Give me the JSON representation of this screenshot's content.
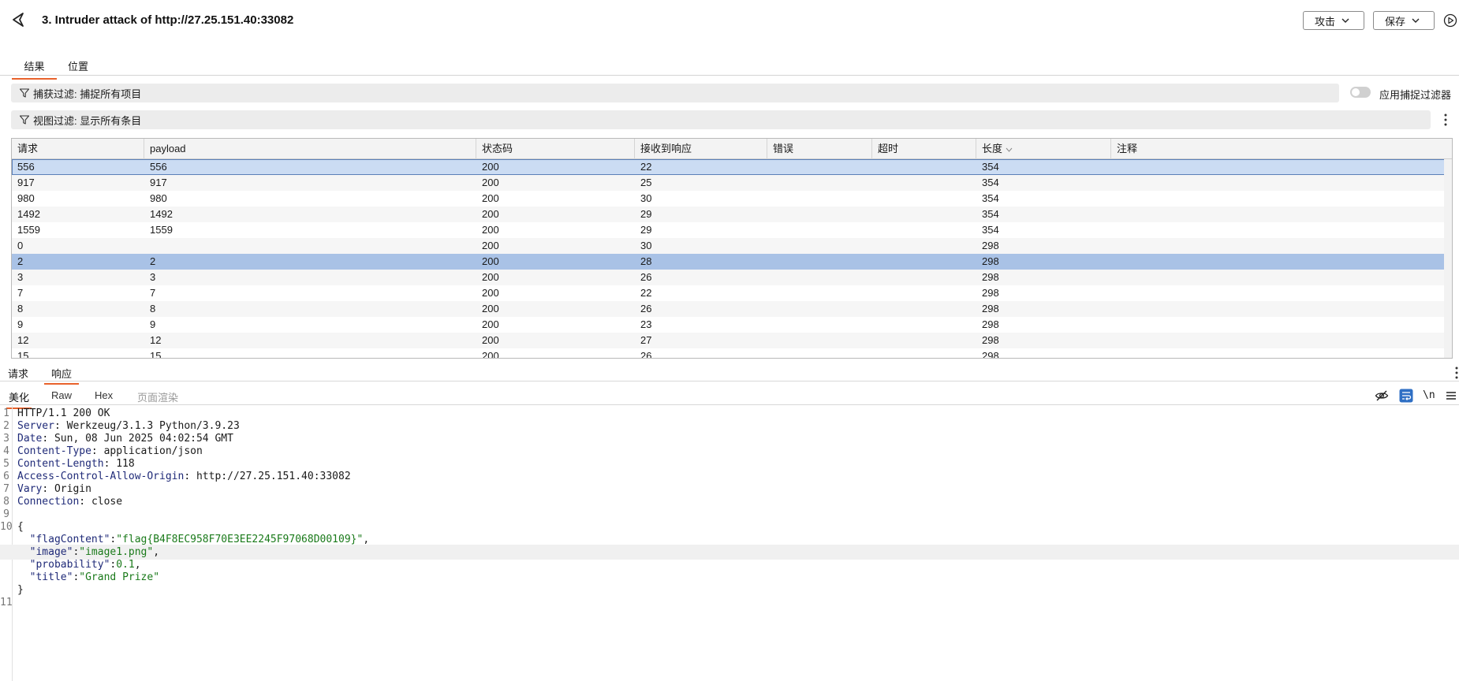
{
  "window": {
    "title": "3. Intruder attack of http://27.25.151.40:33082"
  },
  "toolbar": {
    "attack_label": "攻击",
    "save_label": "保存"
  },
  "tabs": [
    {
      "label": "结果",
      "active": true
    },
    {
      "label": "位置",
      "active": false
    }
  ],
  "filters": {
    "capture": {
      "label": "捕获过滤: 捕捉所有项目"
    },
    "view": {
      "label": "视图过滤: 显示所有条目"
    },
    "apply_toggle": {
      "label": "应用捕捉过滤器",
      "on": false
    }
  },
  "table": {
    "columns": [
      "请求",
      "payload",
      "状态码",
      "接收到响应",
      "错误",
      "超时",
      "长度",
      "注释"
    ],
    "rows": [
      {
        "request": "556",
        "payload": "556",
        "status": "200",
        "received": "22",
        "error": "",
        "timeout": "",
        "length": "354",
        "comment": "",
        "state": "focus"
      },
      {
        "request": "917",
        "payload": "917",
        "status": "200",
        "received": "25",
        "error": "",
        "timeout": "",
        "length": "354",
        "comment": ""
      },
      {
        "request": "980",
        "payload": "980",
        "status": "200",
        "received": "30",
        "error": "",
        "timeout": "",
        "length": "354",
        "comment": ""
      },
      {
        "request": "1492",
        "payload": "1492",
        "status": "200",
        "received": "29",
        "error": "",
        "timeout": "",
        "length": "354",
        "comment": ""
      },
      {
        "request": "1559",
        "payload": "1559",
        "status": "200",
        "received": "29",
        "error": "",
        "timeout": "",
        "length": "354",
        "comment": ""
      },
      {
        "request": "0",
        "payload": "",
        "status": "200",
        "received": "30",
        "error": "",
        "timeout": "",
        "length": "298",
        "comment": ""
      },
      {
        "request": "2",
        "payload": "2",
        "status": "200",
        "received": "28",
        "error": "",
        "timeout": "",
        "length": "298",
        "comment": "",
        "state": "sel"
      },
      {
        "request": "3",
        "payload": "3",
        "status": "200",
        "received": "26",
        "error": "",
        "timeout": "",
        "length": "298",
        "comment": ""
      },
      {
        "request": "7",
        "payload": "7",
        "status": "200",
        "received": "22",
        "error": "",
        "timeout": "",
        "length": "298",
        "comment": ""
      },
      {
        "request": "8",
        "payload": "8",
        "status": "200",
        "received": "26",
        "error": "",
        "timeout": "",
        "length": "298",
        "comment": ""
      },
      {
        "request": "9",
        "payload": "9",
        "status": "200",
        "received": "23",
        "error": "",
        "timeout": "",
        "length": "298",
        "comment": ""
      },
      {
        "request": "12",
        "payload": "12",
        "status": "200",
        "received": "27",
        "error": "",
        "timeout": "",
        "length": "298",
        "comment": ""
      },
      {
        "request": "15",
        "payload": "15",
        "status": "200",
        "received": "26",
        "error": "",
        "timeout": "",
        "length": "298",
        "comment": ""
      }
    ]
  },
  "detail_tabs": [
    {
      "label": "请求",
      "active": false
    },
    {
      "label": "响应",
      "active": true
    }
  ],
  "view_tabs": [
    {
      "label": "美化",
      "active": true
    },
    {
      "label": "Raw",
      "active": false
    },
    {
      "label": "Hex",
      "active": false
    },
    {
      "label": "页面渲染",
      "active": false,
      "disabled": true
    }
  ],
  "editor_tools": {
    "newline_label": "\\n"
  },
  "response": {
    "headers": [
      {
        "line": "1",
        "text": "HTTP/1.1 200 OK"
      },
      {
        "line": "2",
        "name": "Server",
        "value": "Werkzeug/3.1.3 Python/3.9.23"
      },
      {
        "line": "3",
        "name": "Date",
        "value": "Sun, 08 Jun 2025 04:02:54 GMT"
      },
      {
        "line": "4",
        "name": "Content-Type",
        "value": "application/json"
      },
      {
        "line": "5",
        "name": "Content-Length",
        "value": "118"
      },
      {
        "line": "6",
        "name": "Access-Control-Allow-Origin",
        "value": "http://27.25.151.40:33082"
      },
      {
        "line": "7",
        "name": "Vary",
        "value": "Origin"
      },
      {
        "line": "8",
        "name": "Connection",
        "value": "close"
      }
    ],
    "blank_line": "9",
    "body_open": {
      "line": "10",
      "text": "{"
    },
    "body_fields": [
      {
        "key": "\"flagContent\"",
        "value": "\"flag{B4F8EC958F70E3EE2245F97068D00109}\"",
        "sep": ","
      },
      {
        "key": "\"image\"",
        "value": "\"image1.png\"",
        "sep": ",",
        "highlight": true
      },
      {
        "key": "\"probability\"",
        "value": "0.1",
        "sep": ","
      },
      {
        "key": "\"title\"",
        "value": "\"Grand Prize\"",
        "sep": ""
      }
    ],
    "body_close": {
      "text": "}"
    },
    "last_line": "11"
  }
}
